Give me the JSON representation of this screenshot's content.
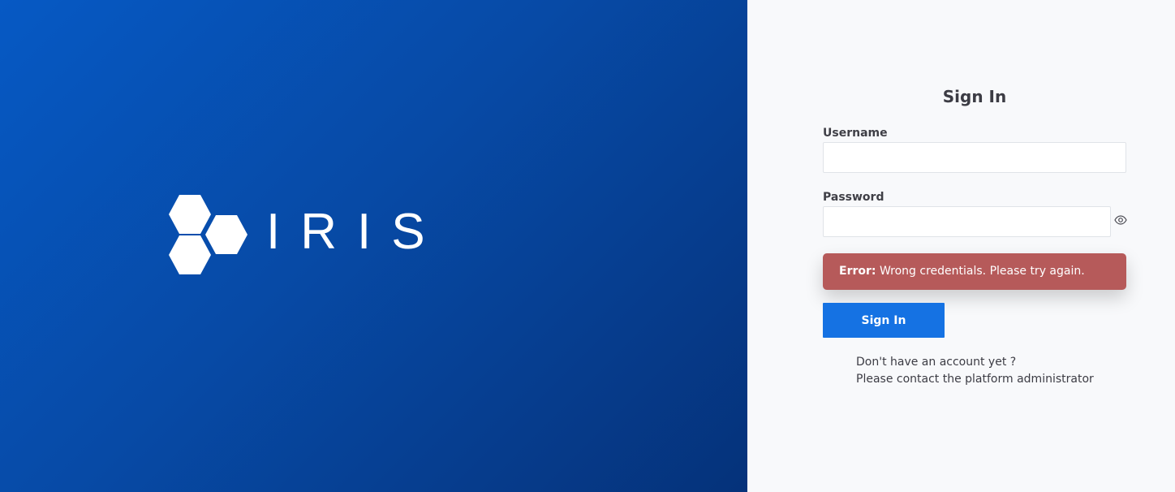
{
  "brand": {
    "name": "IRIS",
    "logo_icon": "hexagon-cluster-icon",
    "colors": {
      "gradient_start": "#0659c4",
      "gradient_end": "#05327a"
    }
  },
  "login_form": {
    "title": "Sign In",
    "username": {
      "label": "Username",
      "value": "",
      "placeholder": ""
    },
    "password": {
      "label": "Password",
      "value": "",
      "placeholder": "",
      "toggle_icon": "eye-icon"
    },
    "error": {
      "prefix": "Error:",
      "message": "Wrong credentials. Please try again.",
      "color": "#b65a5a"
    },
    "submit_label": "Sign In",
    "submit_color": "#1572e3",
    "help": {
      "line1": "Don't have an account yet ?",
      "line2": "Please contact the platform administrator"
    }
  }
}
